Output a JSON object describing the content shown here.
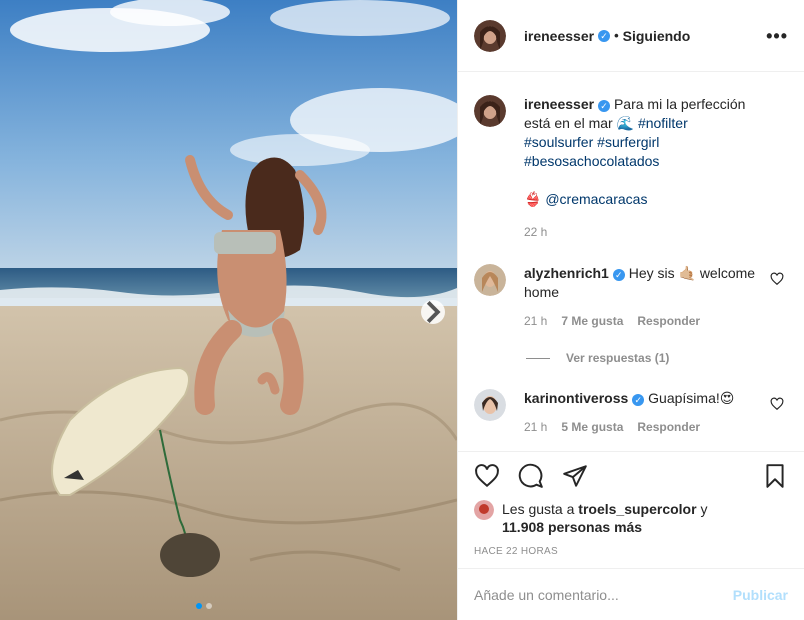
{
  "post": {
    "photo_description_icon": "photo",
    "carousel": {
      "count": 2,
      "active": 0
    }
  },
  "header": {
    "username": "ireneesser",
    "separator": "•",
    "follow_status": "Siguiendo",
    "more": "•••"
  },
  "caption": {
    "username": "ireneesser",
    "text_start": "Para mi la perfección está en el mar",
    "emoji": "🌊",
    "hashtags": [
      "#nofilter",
      "#soulsurfer",
      "#surfergirl",
      "#besosachocolatados"
    ],
    "mention_emoji": "👙",
    "mention": "@cremacaracas",
    "time": "22 h"
  },
  "comments": [
    {
      "username": "alyzhenrich1",
      "text": "Hey sis 🤙🏼 welcome home",
      "time": "21 h",
      "likes": "7 Me gusta",
      "reply": "Responder"
    },
    {
      "username": "karinontiveross",
      "text": "Guapísima!😍",
      "time": "21 h",
      "likes": "5 Me gusta",
      "reply": "Responder"
    }
  ],
  "replies_label": "Ver respuestas (1)",
  "likes": {
    "prefix": "Les gusta a",
    "user": "troels_supercolor",
    "joiner": "y",
    "count": "11.908 personas más"
  },
  "time_ago": "HACE 22 HORAS",
  "add_comment": {
    "placeholder": "Añade un comentario...",
    "publish": "Publicar"
  },
  "colors": {
    "accent": "#0095f6",
    "verified": "#3897f0",
    "link": "#00376b",
    "muted": "#8e8e8e"
  }
}
